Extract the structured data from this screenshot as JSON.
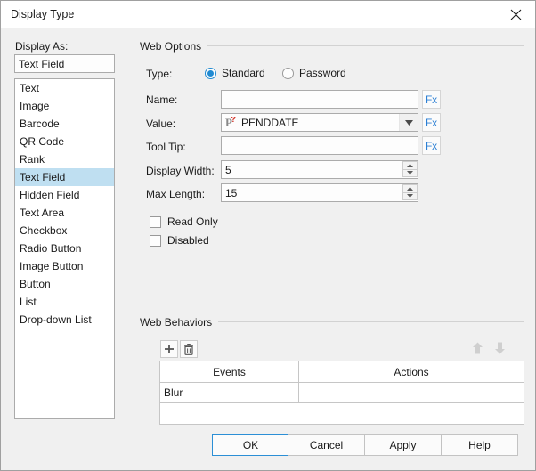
{
  "window": {
    "title": "Display Type",
    "close_icon": "close-icon"
  },
  "left_panel": {
    "label": "Display As:",
    "selected_value": "Text Field",
    "items": [
      "Text",
      "Image",
      "Barcode",
      "QR Code",
      "Rank",
      "Text Field",
      "Hidden Field",
      "Text Area",
      "Checkbox",
      "Radio Button",
      "Image Button",
      "Button",
      "List",
      "Drop-down List"
    ],
    "selected_index": 5
  },
  "web_options": {
    "group_title": "Web Options",
    "type": {
      "label": "Type:",
      "options": [
        "Standard",
        "Password"
      ],
      "selected": "Standard"
    },
    "name": {
      "label": "Name:",
      "value": "",
      "fx_label": "Fx"
    },
    "value": {
      "label": "Value:",
      "value": "PENDDATE",
      "icon": "parameter-icon",
      "fx_label": "Fx"
    },
    "tool_tip": {
      "label": "Tool Tip:",
      "value": "",
      "fx_label": "Fx"
    },
    "display_width": {
      "label": "Display Width:",
      "value": "5"
    },
    "max_length": {
      "label": "Max Length:",
      "value": "15"
    },
    "read_only": {
      "label": "Read Only",
      "checked": false
    },
    "disabled": {
      "label": "Disabled",
      "checked": false
    }
  },
  "web_behaviors": {
    "group_title": "Web Behaviors",
    "toolbar": {
      "add_icon": "plus-icon",
      "delete_icon": "trash-icon",
      "move_up_icon": "arrow-up-icon",
      "move_down_icon": "arrow-down-icon"
    },
    "columns": [
      "Events",
      "Actions"
    ],
    "rows": [
      {
        "event": "Blur",
        "action": ""
      }
    ]
  },
  "footer": {
    "ok": "OK",
    "cancel": "Cancel",
    "apply": "Apply",
    "help": "Help"
  },
  "colors": {
    "accent": "#1f8ad2",
    "selection": "#bfdff1",
    "fx_link": "#2b7fd4",
    "param_red": "#d4342a"
  }
}
